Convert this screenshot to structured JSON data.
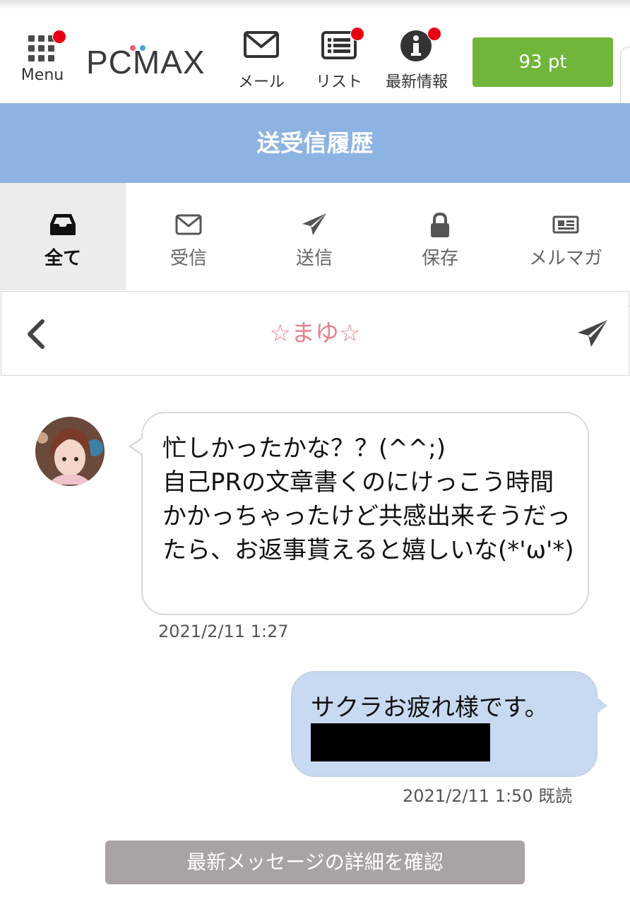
{
  "header": {
    "menu_label": "Menu",
    "logo_text": "PCMAX",
    "mail_label": "メール",
    "list_label": "リスト",
    "news_label": "最新情報",
    "points_label": "93 pt"
  },
  "page": {
    "title": "送受信履歴"
  },
  "tabs": [
    {
      "label": "全て",
      "icon": "inbox-icon",
      "active": true
    },
    {
      "label": "受信",
      "icon": "envelope-icon"
    },
    {
      "label": "送信",
      "icon": "paper-plane-icon"
    },
    {
      "label": "保存",
      "icon": "lock-icon"
    },
    {
      "label": "メルマガ",
      "icon": "newspaper-icon"
    }
  ],
  "conversation": {
    "partner_name": "☆まゆ☆",
    "messages": [
      {
        "direction": "incoming",
        "text": "忙しかったかな？？(^^;)\n自己PRの文章書くのにけっこう時間かかっちゃったけど共感出来そうだったら、お返事貰えると嬉しいな(*'ω'*)",
        "timestamp": "2021/2/11 1:27"
      },
      {
        "direction": "outgoing",
        "text": "サクラお疲れ様です。",
        "timestamp": "2021/2/11 1:50 既読"
      }
    ]
  },
  "footer": {
    "confirm_label": "最新メッセージの詳細を確認"
  },
  "colors": {
    "title_band": "#8db3e2",
    "points_button": "#6fb63a",
    "notification_dot": "#e60012",
    "partner_name": "#e8818d",
    "outgoing_bubble": "#c8daf1",
    "confirm_button": "#a9a3a3"
  }
}
